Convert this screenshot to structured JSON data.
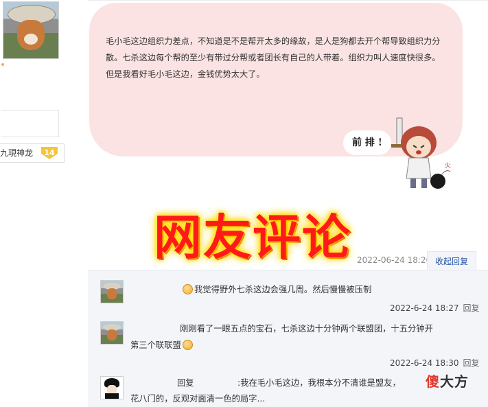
{
  "left": {
    "user_name": "九現神龙",
    "level": "14"
  },
  "post": {
    "paragraphs": [
      "毛小毛这边组织力差点，不知道是不是帮开太多的缘故，是人是狗都去开个帮导致组织力分散。七杀这边每个帮的至少有带过分帮或者团长有自己的人带着。组织力叫人速度快很多。",
      "但是我看好毛小毛这边，金钱优势太大了。"
    ],
    "sticker_text": "前 排 !",
    "timestamp": "2022-06-24 18:26",
    "collapse_label": "收起回复"
  },
  "banner": {
    "title": "网友评论"
  },
  "replies": [
    {
      "text": "我觉得野外七杀这边会强几周。然后慢慢被压制",
      "timestamp": "2022-6-24 18:27",
      "reply_label": "回复",
      "emoji": "smile-emoji"
    },
    {
      "text_line1": "刚刚看了一眼五点的宝石，七杀这边十分钟两个联盟团，十五分钟开",
      "text_line2": "第三个联联盟",
      "timestamp": "2022-6-24 18:30",
      "reply_label": "回复",
      "emoji": "grin-emoji"
    },
    {
      "prefix": "回复",
      "text_line1": ":我在毛小毛这边，我根本分不清谁是盟友，",
      "text_line2": "花八门的，反观对面清一色的局字..."
    }
  ],
  "watermark": {
    "part1": "傻",
    "part2": "大方"
  },
  "colors": {
    "bubble_bg": "#fbe3e3",
    "title_red": "#ff1a1a",
    "title_glow": "#ffe000",
    "link_blue": "#2b5aa8",
    "reply_panel_bg": "#f3f5f9"
  }
}
